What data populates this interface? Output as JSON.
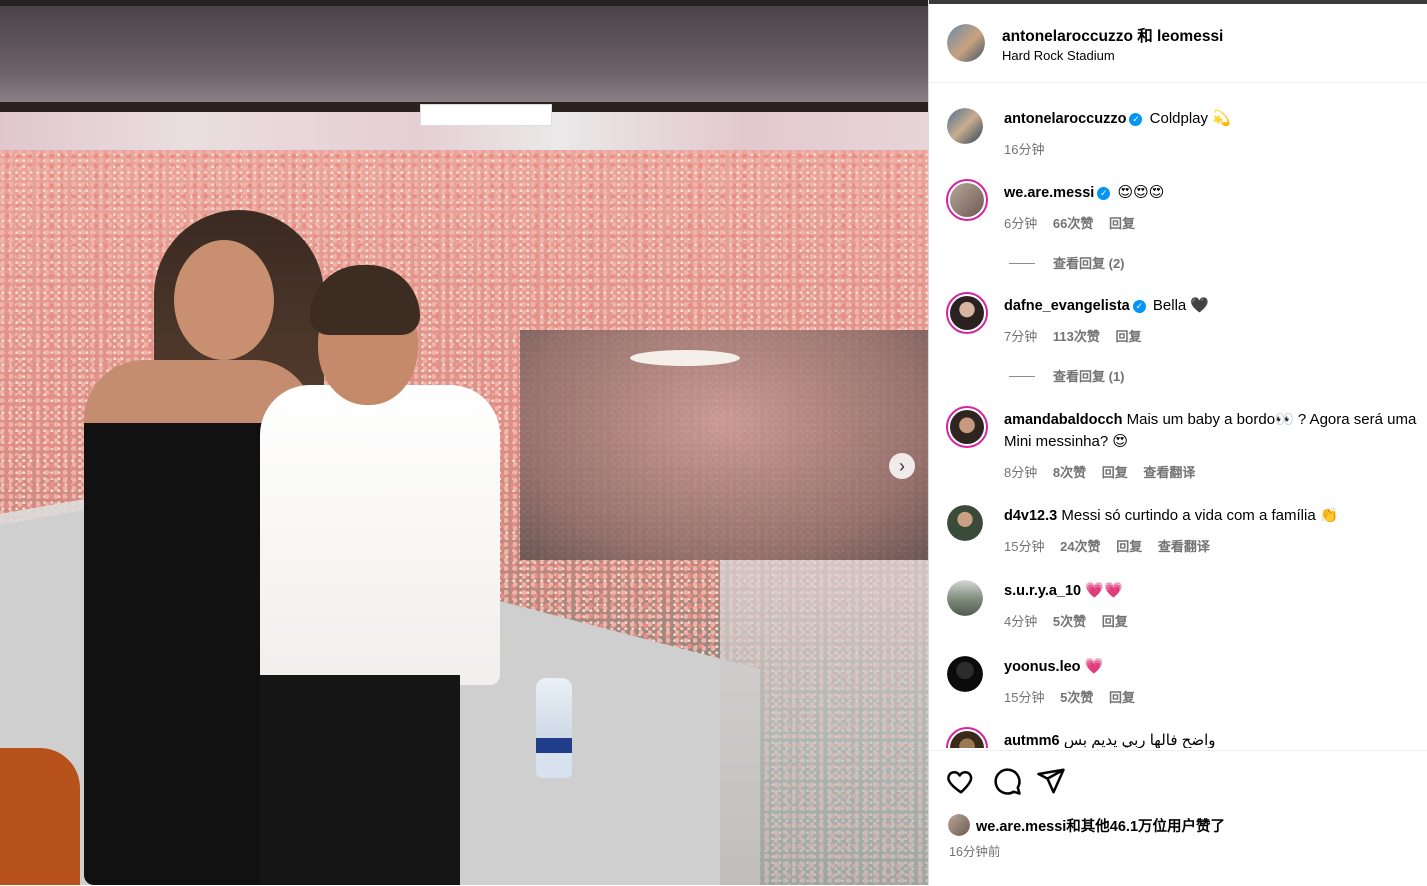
{
  "header": {
    "title": "antonelaroccuzzo 和 leomessi",
    "location": "Hard Rock Stadium"
  },
  "caption": {
    "username": "antonelaroccuzzo",
    "text": "Coldplay 💫",
    "time": "16分钟"
  },
  "comments": [
    {
      "username": "we.are.messi",
      "verified": true,
      "text": "😍😍😍",
      "time": "6分钟",
      "likes": "66次赞",
      "reply": "回复",
      "view_replies": "查看回复 (2)"
    },
    {
      "username": "dafne_evangelista",
      "verified": true,
      "text": "Bella 🖤",
      "time": "7分钟",
      "likes": "113次赞",
      "reply": "回复",
      "view_replies": "查看回复 (1)"
    },
    {
      "username": "amandabaldocch",
      "verified": false,
      "text": "Mais um baby a bordo👀 ? Agora será uma",
      "text2": "Mini messinha? 😍",
      "time": "8分钟",
      "likes": "8次赞",
      "reply": "回复",
      "translate": "查看翻译"
    },
    {
      "username": "d4v12.3",
      "verified": false,
      "text": "Messi só curtindo a vida com a família 👏",
      "time": "15分钟",
      "likes": "24次赞",
      "reply": "回复",
      "translate": "查看翻译"
    },
    {
      "username": "s.u.r.y.a_10",
      "verified": false,
      "text": "💗💗",
      "time": "4分钟",
      "likes": "5次赞",
      "reply": "回复"
    },
    {
      "username": "yoonus.leo",
      "verified": false,
      "text": "💗",
      "time": "15分钟",
      "likes": "5次赞",
      "reply": "回复"
    },
    {
      "username": "autmm6",
      "verified": false,
      "text": "واضح فالها ربي يديم بس"
    }
  ],
  "likes_summary": {
    "user": "we.are.messi",
    "rest": "和其他46.1万位用户赞了"
  },
  "posted_ago": "16分钟前",
  "icons": [
    "heart-icon",
    "comment-icon",
    "share-icon",
    "chevron-right-icon",
    "verified-icon"
  ],
  "colors": {
    "verified": "#0095f6",
    "muted": "#737373",
    "story_ring": "#d6249f"
  }
}
